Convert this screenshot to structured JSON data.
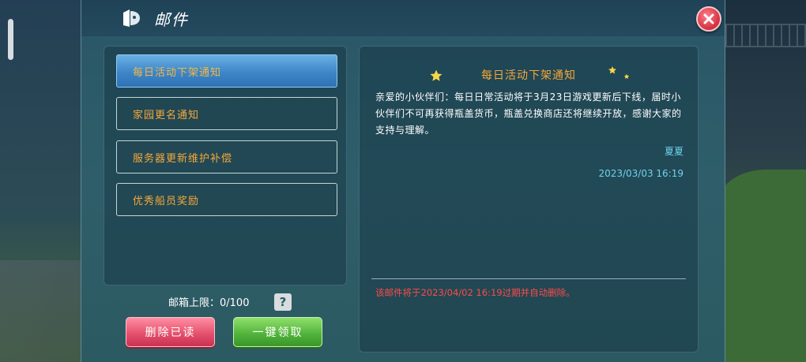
{
  "window": {
    "title": "邮件"
  },
  "mail_list": {
    "items": [
      {
        "label": "每日活动下架通知",
        "active": true
      },
      {
        "label": "家园更名通知",
        "active": false
      },
      {
        "label": "服务器更新维护补偿",
        "active": false
      },
      {
        "label": "优秀船员奖励",
        "active": false
      }
    ]
  },
  "footer": {
    "mailbox_limit": "邮箱上限：0/100",
    "help_label": "?",
    "delete_read_label": "删除已读",
    "claim_all_label": "一键领取"
  },
  "detail": {
    "title": "每日活动下架通知",
    "body": "亲爱的小伙伴们：每日日常活动将于3月23日游戏更新后下线，届时小伙伴们不可再获得瓶盖货币，瓶盖兑换商店还将继续开放，感谢大家的支持与理解。",
    "sender": "夏夏",
    "date": "2023/03/03 16:19",
    "expire_note": "该邮件将于2023/04/02 16:19过期并自动删除。"
  },
  "colors": {
    "accent_orange": "#f7a83a",
    "link_cyan": "#6fd3ec",
    "warning_red": "#ff4a4a",
    "active_blue": "#3d86c8"
  },
  "icons": {
    "mail": "mail-icon",
    "close": "close-icon",
    "help": "question-icon",
    "star": "star-icon"
  }
}
